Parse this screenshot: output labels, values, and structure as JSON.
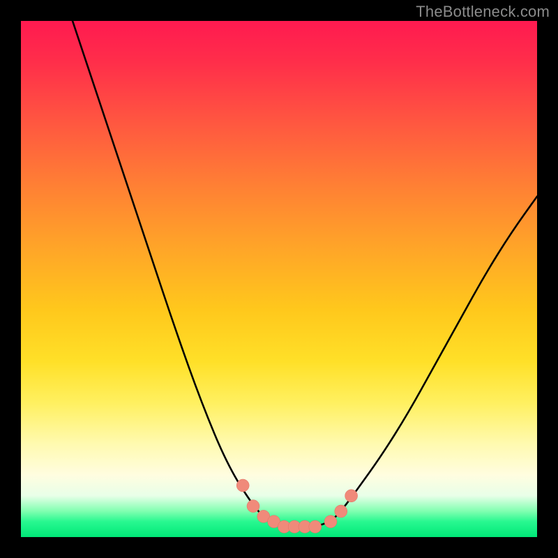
{
  "watermark": "TheBottleneck.com",
  "chart_data": {
    "type": "line",
    "title": "",
    "xlabel": "",
    "ylabel": "",
    "xlim": [
      0,
      100
    ],
    "ylim": [
      0,
      100
    ],
    "series": [
      {
        "name": "bottleneck-curve",
        "x": [
          10,
          15,
          20,
          25,
          30,
          35,
          40,
          45,
          48,
          50,
          52,
          55,
          57,
          60,
          62,
          65,
          70,
          75,
          80,
          85,
          90,
          95,
          100
        ],
        "values": [
          100,
          85,
          70,
          55,
          40,
          26,
          14,
          6,
          3,
          2,
          2,
          2,
          2,
          3,
          5,
          9,
          16,
          24,
          33,
          42,
          51,
          59,
          66
        ]
      }
    ],
    "markers": {
      "name": "highlight-dots",
      "color": "#f28b82",
      "x": [
        43,
        45,
        47,
        49,
        51,
        53,
        55,
        57,
        60,
        62,
        64
      ],
      "values": [
        10,
        6,
        4,
        3,
        2,
        2,
        2,
        2,
        3,
        5,
        8
      ]
    },
    "background_gradient": {
      "stops": [
        {
          "pos": 0,
          "color": "#ff1a50"
        },
        {
          "pos": 20,
          "color": "#ff5840"
        },
        {
          "pos": 44,
          "color": "#ffa528"
        },
        {
          "pos": 66,
          "color": "#ffe028"
        },
        {
          "pos": 88,
          "color": "#fffde0"
        },
        {
          "pos": 97,
          "color": "#28f890"
        },
        {
          "pos": 100,
          "color": "#00e878"
        }
      ]
    }
  }
}
